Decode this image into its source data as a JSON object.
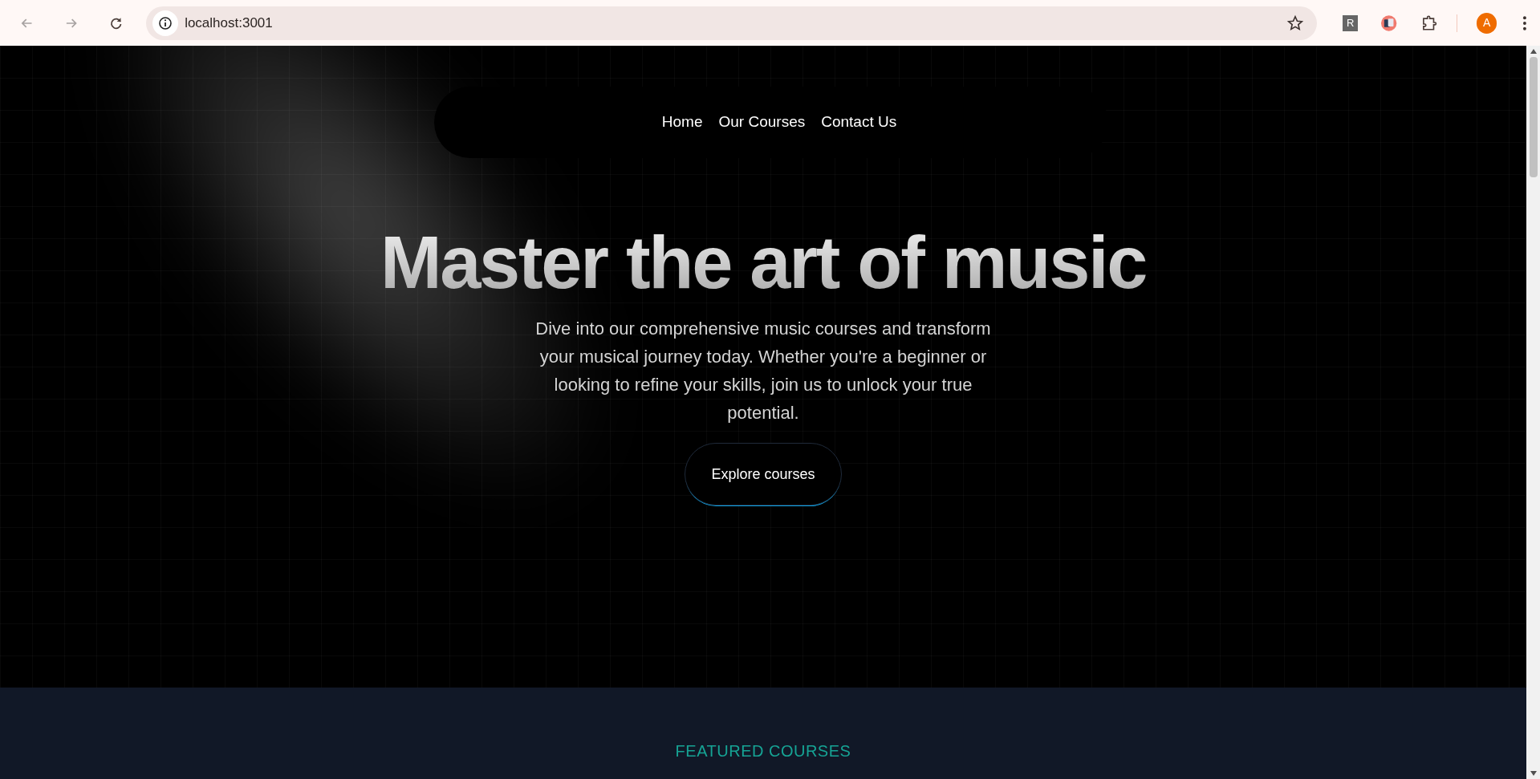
{
  "browser": {
    "url": "localhost:3001",
    "profile_initial": "A",
    "extension_initial": "R"
  },
  "nav": {
    "links": [
      "Home",
      "Our Courses",
      "Contact Us"
    ]
  },
  "hero": {
    "title": "Master the art of music",
    "text": "Dive into our comprehensive music courses and transform your musical journey today. Whether you're a beginner or looking to refine your skills, join us to unlock your true potential.",
    "button": "Explore courses"
  },
  "featured": {
    "eyebrow": "FEATURED COURSES"
  }
}
